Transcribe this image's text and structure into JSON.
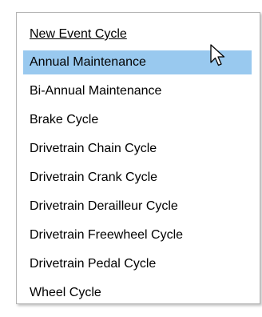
{
  "menu": {
    "header": "New Event Cycle",
    "items": [
      {
        "label": "Annual Maintenance"
      },
      {
        "label": "Bi-Annual Maintenance"
      },
      {
        "label": "Brake Cycle"
      },
      {
        "label": "Drivetrain Chain Cycle"
      },
      {
        "label": "Drivetrain Crank Cycle"
      },
      {
        "label": "Drivetrain Derailleur Cycle"
      },
      {
        "label": "Drivetrain Freewheel Cycle"
      },
      {
        "label": "Drivetrain Pedal Cycle"
      },
      {
        "label": "Wheel Cycle"
      }
    ],
    "hovered_item": "Annual Maintenance",
    "hover_color": "#99c9ef"
  },
  "cursor": {
    "icon": "mouse-pointer-icon"
  }
}
